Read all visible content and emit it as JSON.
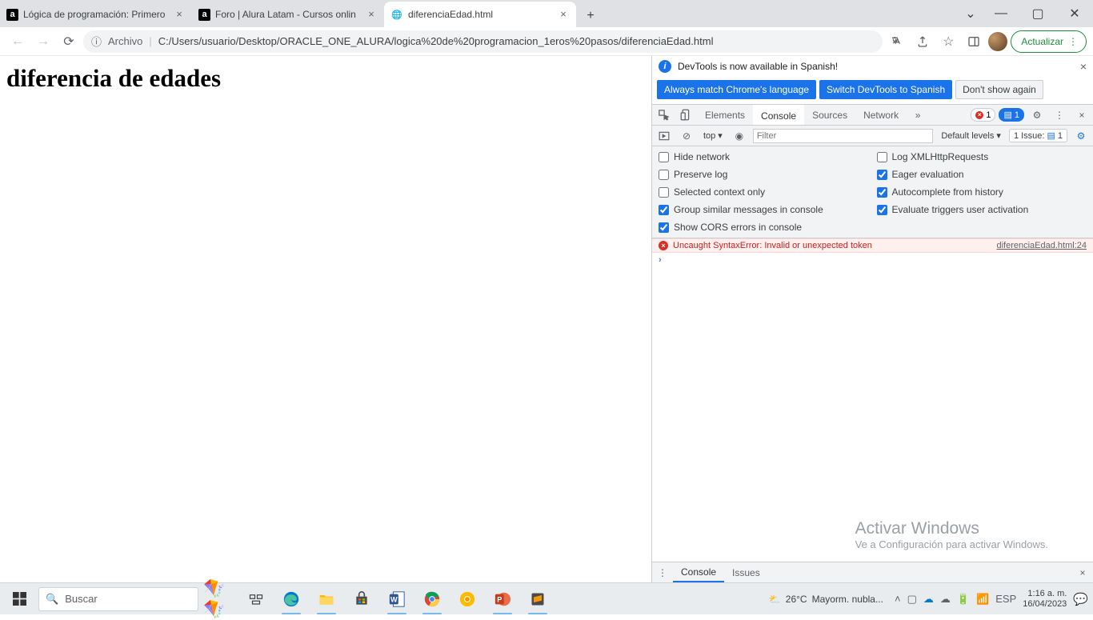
{
  "browser": {
    "tabs": [
      {
        "label": "Lógica de programación: Primero",
        "fav": "a"
      },
      {
        "label": "Foro | Alura Latam - Cursos onlin",
        "fav": "a"
      },
      {
        "label": "diferenciaEdad.html",
        "fav": "globe",
        "active": true
      }
    ],
    "url_prefix": "Archivo",
    "url": "C:/Users/usuario/Desktop/ORACLE_ONE_ALURA/logica%20de%20programacion_1eros%20pasos/diferenciaEdad.html",
    "update_label": "Actualizar"
  },
  "page": {
    "heading": "diferencia de edades"
  },
  "devtools": {
    "notice": "DevTools is now available in Spanish!",
    "lang_buttons": {
      "match": "Always match Chrome's language",
      "switch": "Switch DevTools to Spanish",
      "dont": "Don't show again"
    },
    "tabs": {
      "elements": "Elements",
      "console": "Console",
      "sources": "Sources",
      "network": "Network"
    },
    "err_badge": "1",
    "msg_badge": "1",
    "toolbar": {
      "context": "top",
      "filter_placeholder": "Filter",
      "levels": "Default levels ▾",
      "issues": "1 Issue:",
      "issues_count": "1"
    },
    "settings": {
      "hide_network": "Hide network",
      "preserve_log": "Preserve log",
      "selected_ctx": "Selected context only",
      "group_similar": "Group similar messages in console",
      "show_cors": "Show CORS errors in console",
      "log_xhr": "Log XMLHttpRequests",
      "eager_eval": "Eager evaluation",
      "autocomplete": "Autocomplete from history",
      "eval_trigger": "Evaluate triggers user activation"
    },
    "error": {
      "text": "Uncaught SyntaxError: Invalid or unexpected token",
      "source": "diferenciaEdad.html:24"
    },
    "drawer": {
      "console": "Console",
      "issues": "Issues"
    }
  },
  "watermark": {
    "line1": "Activar Windows",
    "line2": "Ve a Configuración para activar Windows."
  },
  "taskbar": {
    "search_placeholder": "Buscar",
    "weather": {
      "temp": "26°C",
      "desc": "Mayorm. nubla..."
    },
    "lang": "ESP",
    "time": "1:16 a. m.",
    "date": "16/04/2023"
  }
}
